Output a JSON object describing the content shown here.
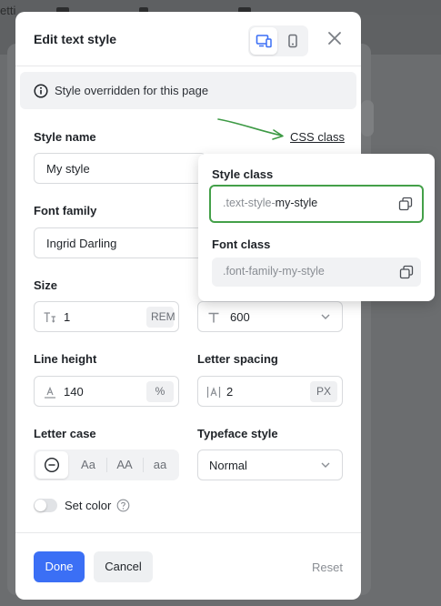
{
  "background": {
    "partial_text": "etti"
  },
  "modal": {
    "title": "Edit text style",
    "info": "Style overridden for this page",
    "style_name": {
      "label": "Style name",
      "value": "My style"
    },
    "css_link": "CSS class",
    "font_family": {
      "label": "Font family",
      "value": "Ingrid Darling"
    },
    "size": {
      "label": "Size",
      "value": "1",
      "unit": "REM"
    },
    "weight": {
      "value": "600"
    },
    "line_height": {
      "label": "Line height",
      "value": "140",
      "unit": "%"
    },
    "letter_spacing": {
      "label": "Letter spacing",
      "value": "2",
      "unit": "PX"
    },
    "letter_case": {
      "label": "Letter case",
      "options": [
        "Aa",
        "AA",
        "aa"
      ]
    },
    "typeface_style": {
      "label": "Typeface style",
      "value": "Normal"
    },
    "set_color": {
      "label": "Set color",
      "enabled": false
    },
    "footer": {
      "done": "Done",
      "cancel": "Cancel",
      "reset": "Reset"
    }
  },
  "popover": {
    "style_class": {
      "label": "Style class",
      "prefix": ".text-style-",
      "name": "my-style"
    },
    "font_class": {
      "label": "Font class",
      "value": ".font-family-my-style"
    }
  },
  "colors": {
    "primary": "#3b6ff5",
    "focus_border": "#44a049",
    "arrow": "#3d9a45"
  },
  "icons": [
    "desktop-icon",
    "mobile-icon",
    "close-icon",
    "info-icon",
    "text-size-icon",
    "weight-icon",
    "chevron-down-icon",
    "line-height-icon",
    "letter-spacing-icon",
    "minus-circle-icon",
    "help-icon",
    "copy-icon",
    "arrow-icon"
  ]
}
